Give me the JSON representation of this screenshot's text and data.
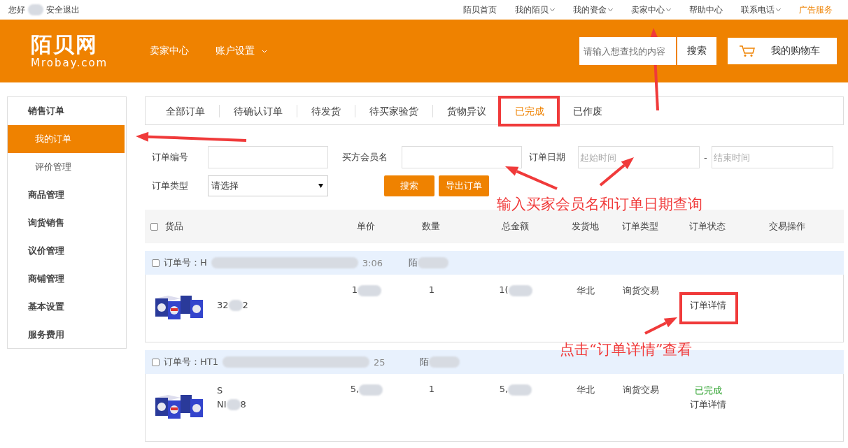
{
  "topbar": {
    "greeting": "您好",
    "logout": "安全退出",
    "links": [
      {
        "label": "陌贝首页",
        "dropdown": false,
        "highlight": false
      },
      {
        "label": "我的陌贝",
        "dropdown": true,
        "highlight": false
      },
      {
        "label": "我的资金",
        "dropdown": true,
        "highlight": false
      },
      {
        "label": "卖家中心",
        "dropdown": true,
        "highlight": false
      },
      {
        "label": "帮助中心",
        "dropdown": false,
        "highlight": false
      },
      {
        "label": "联系电话",
        "dropdown": true,
        "highlight": false
      },
      {
        "label": "广告服务",
        "dropdown": false,
        "highlight": true
      }
    ]
  },
  "header": {
    "logo": {
      "name": "陌贝网",
      "domain": "Mrobay.com"
    },
    "nav": [
      {
        "label": "卖家中心",
        "dropdown": false
      },
      {
        "label": "账户设置",
        "dropdown": true
      }
    ],
    "search": {
      "placeholder": "请输入想查找的内容",
      "button": "搜索"
    },
    "cart": "我的购物车"
  },
  "sidebar": {
    "items": [
      {
        "label": "销售订单",
        "kind": "group",
        "selected": false
      },
      {
        "label": "我的订单",
        "kind": "sub",
        "selected": true
      },
      {
        "label": "评价管理",
        "kind": "sub",
        "selected": false
      },
      {
        "label": "商品管理",
        "kind": "group",
        "selected": false
      },
      {
        "label": "询货销售",
        "kind": "group",
        "selected": false
      },
      {
        "label": "议价管理",
        "kind": "group",
        "selected": false
      },
      {
        "label": "商铺管理",
        "kind": "group",
        "selected": false
      },
      {
        "label": "基本设置",
        "kind": "group",
        "selected": false
      },
      {
        "label": "服务费用",
        "kind": "group",
        "selected": false
      }
    ]
  },
  "tabs": [
    {
      "label": "全部订单",
      "selected": false
    },
    {
      "label": "待确认订单",
      "selected": false
    },
    {
      "label": "待发货",
      "selected": false
    },
    {
      "label": "待买家验货",
      "selected": false
    },
    {
      "label": "货物异议",
      "selected": false
    },
    {
      "label": "已完成",
      "selected": true
    },
    {
      "label": "已作废",
      "selected": false
    }
  ],
  "filters": {
    "order_no": "订单编号",
    "buyer": "买方会员名",
    "date": "订单日期",
    "start_placeholder": "起始时间",
    "separator": "-",
    "end_placeholder": "结束时间",
    "type": "订单类型",
    "type_value": "请选择",
    "search_button": "搜索",
    "export_button": "导出订单"
  },
  "table": {
    "select_all": {
      "checked": false
    },
    "columns": [
      "货品",
      "单价",
      "数量",
      "总金额",
      "发货地",
      "订单类型",
      "订单状态",
      "交易操作"
    ],
    "orders": [
      {
        "checked": false,
        "order_label": "订单号：",
        "order_no": "H",
        "time": "3:06",
        "seller": "陌",
        "name_line2": "32",
        "name_tail": "2",
        "price": "1",
        "quantity": "1",
        "total": "1(",
        "origin": "华北",
        "type": "询货交易",
        "action": "订单详情"
      },
      {
        "checked": false,
        "order_label": "订单号：",
        "order_no": "HT1",
        "time": "25",
        "seller": "陌",
        "name_line1": "S",
        "name_line2": "NI",
        "name_tail": "8",
        "price": "5,",
        "quantity": "1",
        "total": "5,",
        "origin": "华北",
        "type": "询货交易",
        "status": "已完成",
        "action": "订单详情"
      }
    ]
  },
  "annotations": {
    "search_hint": "输入买家会员名和订单日期查询",
    "detail_hint": "点击“订单详情”查看"
  }
}
